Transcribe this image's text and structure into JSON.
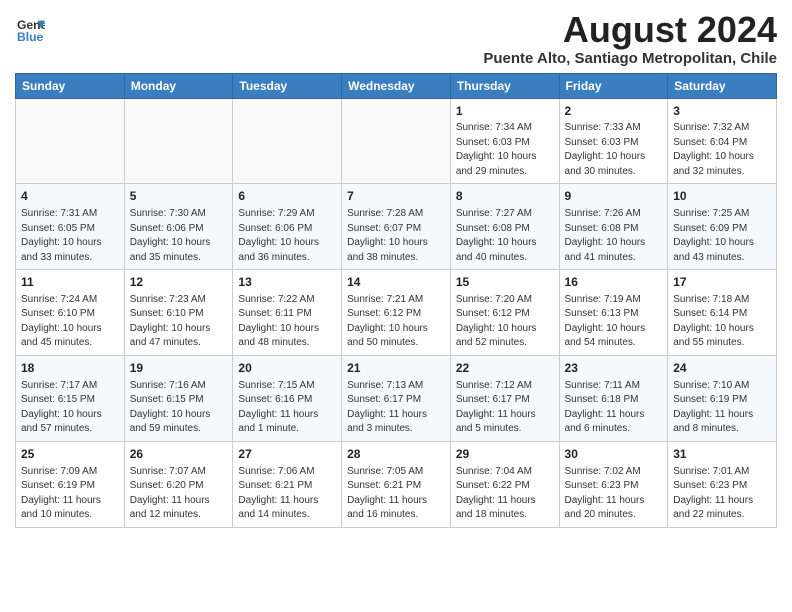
{
  "header": {
    "logo_general": "General",
    "logo_blue": "Blue",
    "title": "August 2024",
    "subtitle": "Puente Alto, Santiago Metropolitan, Chile"
  },
  "days_of_week": [
    "Sunday",
    "Monday",
    "Tuesday",
    "Wednesday",
    "Thursday",
    "Friday",
    "Saturday"
  ],
  "weeks": [
    [
      {
        "day": "",
        "empty": true
      },
      {
        "day": "",
        "empty": true
      },
      {
        "day": "",
        "empty": true
      },
      {
        "day": "",
        "empty": true
      },
      {
        "day": "1",
        "sunrise": "7:34 AM",
        "sunset": "6:03 PM",
        "daylight": "10 hours and 29 minutes."
      },
      {
        "day": "2",
        "sunrise": "7:33 AM",
        "sunset": "6:03 PM",
        "daylight": "10 hours and 30 minutes."
      },
      {
        "day": "3",
        "sunrise": "7:32 AM",
        "sunset": "6:04 PM",
        "daylight": "10 hours and 32 minutes."
      }
    ],
    [
      {
        "day": "4",
        "sunrise": "7:31 AM",
        "sunset": "6:05 PM",
        "daylight": "10 hours and 33 minutes."
      },
      {
        "day": "5",
        "sunrise": "7:30 AM",
        "sunset": "6:06 PM",
        "daylight": "10 hours and 35 minutes."
      },
      {
        "day": "6",
        "sunrise": "7:29 AM",
        "sunset": "6:06 PM",
        "daylight": "10 hours and 36 minutes."
      },
      {
        "day": "7",
        "sunrise": "7:28 AM",
        "sunset": "6:07 PM",
        "daylight": "10 hours and 38 minutes."
      },
      {
        "day": "8",
        "sunrise": "7:27 AM",
        "sunset": "6:08 PM",
        "daylight": "10 hours and 40 minutes."
      },
      {
        "day": "9",
        "sunrise": "7:26 AM",
        "sunset": "6:08 PM",
        "daylight": "10 hours and 41 minutes."
      },
      {
        "day": "10",
        "sunrise": "7:25 AM",
        "sunset": "6:09 PM",
        "daylight": "10 hours and 43 minutes."
      }
    ],
    [
      {
        "day": "11",
        "sunrise": "7:24 AM",
        "sunset": "6:10 PM",
        "daylight": "10 hours and 45 minutes."
      },
      {
        "day": "12",
        "sunrise": "7:23 AM",
        "sunset": "6:10 PM",
        "daylight": "10 hours and 47 minutes."
      },
      {
        "day": "13",
        "sunrise": "7:22 AM",
        "sunset": "6:11 PM",
        "daylight": "10 hours and 48 minutes."
      },
      {
        "day": "14",
        "sunrise": "7:21 AM",
        "sunset": "6:12 PM",
        "daylight": "10 hours and 50 minutes."
      },
      {
        "day": "15",
        "sunrise": "7:20 AM",
        "sunset": "6:12 PM",
        "daylight": "10 hours and 52 minutes."
      },
      {
        "day": "16",
        "sunrise": "7:19 AM",
        "sunset": "6:13 PM",
        "daylight": "10 hours and 54 minutes."
      },
      {
        "day": "17",
        "sunrise": "7:18 AM",
        "sunset": "6:14 PM",
        "daylight": "10 hours and 55 minutes."
      }
    ],
    [
      {
        "day": "18",
        "sunrise": "7:17 AM",
        "sunset": "6:15 PM",
        "daylight": "10 hours and 57 minutes."
      },
      {
        "day": "19",
        "sunrise": "7:16 AM",
        "sunset": "6:15 PM",
        "daylight": "10 hours and 59 minutes."
      },
      {
        "day": "20",
        "sunrise": "7:15 AM",
        "sunset": "6:16 PM",
        "daylight": "11 hours and 1 minute."
      },
      {
        "day": "21",
        "sunrise": "7:13 AM",
        "sunset": "6:17 PM",
        "daylight": "11 hours and 3 minutes."
      },
      {
        "day": "22",
        "sunrise": "7:12 AM",
        "sunset": "6:17 PM",
        "daylight": "11 hours and 5 minutes."
      },
      {
        "day": "23",
        "sunrise": "7:11 AM",
        "sunset": "6:18 PM",
        "daylight": "11 hours and 6 minutes."
      },
      {
        "day": "24",
        "sunrise": "7:10 AM",
        "sunset": "6:19 PM",
        "daylight": "11 hours and 8 minutes."
      }
    ],
    [
      {
        "day": "25",
        "sunrise": "7:09 AM",
        "sunset": "6:19 PM",
        "daylight": "11 hours and 10 minutes."
      },
      {
        "day": "26",
        "sunrise": "7:07 AM",
        "sunset": "6:20 PM",
        "daylight": "11 hours and 12 minutes."
      },
      {
        "day": "27",
        "sunrise": "7:06 AM",
        "sunset": "6:21 PM",
        "daylight": "11 hours and 14 minutes."
      },
      {
        "day": "28",
        "sunrise": "7:05 AM",
        "sunset": "6:21 PM",
        "daylight": "11 hours and 16 minutes."
      },
      {
        "day": "29",
        "sunrise": "7:04 AM",
        "sunset": "6:22 PM",
        "daylight": "11 hours and 18 minutes."
      },
      {
        "day": "30",
        "sunrise": "7:02 AM",
        "sunset": "6:23 PM",
        "daylight": "11 hours and 20 minutes."
      },
      {
        "day": "31",
        "sunrise": "7:01 AM",
        "sunset": "6:23 PM",
        "daylight": "11 hours and 22 minutes."
      }
    ]
  ]
}
